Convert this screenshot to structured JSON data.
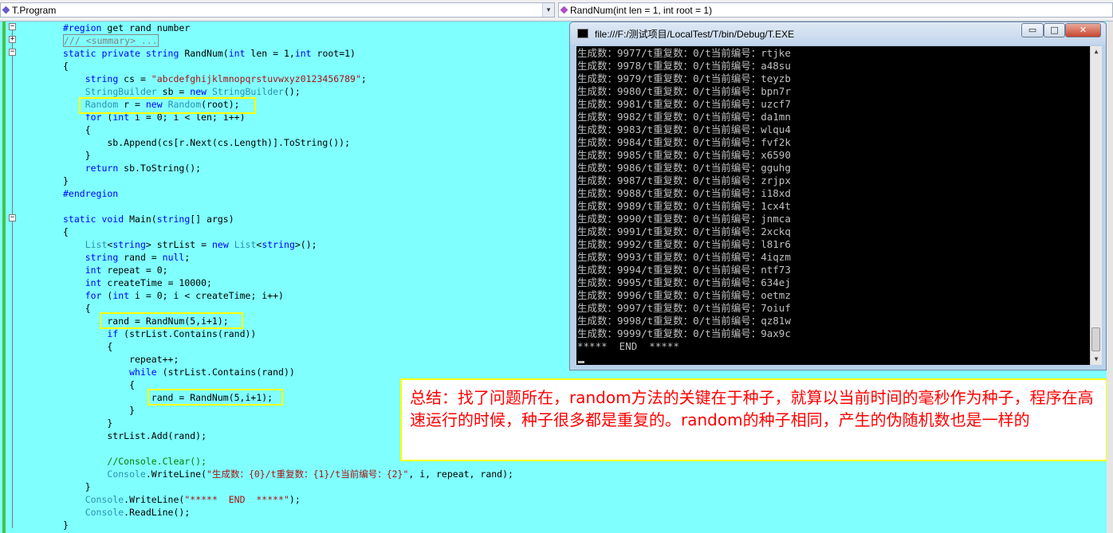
{
  "navbar": {
    "class_combo": "T.Program",
    "member_combo": "RandNum(int len = 1, int root = 1)",
    "dropdown_glyph": "▾"
  },
  "code_lines": [
    {
      "parts": [
        [
          "kw",
          "#region"
        ],
        [
          "",
          " get rand number"
        ]
      ]
    },
    {
      "parts": [
        [
          "cmt",
          "/// <summary> ..."
        ]
      ]
    },
    {
      "parts": [
        [
          "kw",
          "static private string "
        ],
        [
          "",
          "RandNum("
        ],
        [
          "kw",
          "int"
        ],
        [
          "",
          " len = 1,"
        ],
        [
          "kw",
          "int"
        ],
        [
          "",
          " root=1)"
        ]
      ]
    },
    {
      "parts": [
        [
          "",
          "{"
        ]
      ]
    },
    {
      "parts": [
        [
          "",
          "    "
        ],
        [
          "kw",
          "string"
        ],
        [
          "",
          " cs = "
        ],
        [
          "st",
          "\"abcdefghijklmnopqrstuvwxyz0123456789\""
        ],
        [
          "",
          ";"
        ]
      ]
    },
    {
      "parts": [
        [
          "",
          "    "
        ],
        [
          "ty",
          "StringBuilder"
        ],
        [
          "",
          " sb = "
        ],
        [
          "kw",
          "new "
        ],
        [
          "ty",
          "StringBuilder"
        ],
        [
          "",
          "();"
        ]
      ]
    },
    {
      "parts": [
        [
          "",
          "    "
        ],
        [
          "ty",
          "Random"
        ],
        [
          "",
          " r = "
        ],
        [
          "kw",
          "new "
        ],
        [
          "ty",
          "Random"
        ],
        [
          "",
          "(root);"
        ]
      ]
    },
    {
      "parts": [
        [
          "",
          "    "
        ],
        [
          "kw",
          "for"
        ],
        [
          "",
          " ("
        ],
        [
          "kw",
          "int"
        ],
        [
          "",
          " i = 0; i < len; i++)"
        ]
      ]
    },
    {
      "parts": [
        [
          "",
          "    {"
        ]
      ]
    },
    {
      "parts": [
        [
          "",
          "        sb.Append(cs[r.Next(cs.Length)].ToString());"
        ]
      ]
    },
    {
      "parts": [
        [
          "",
          "    }"
        ]
      ]
    },
    {
      "parts": [
        [
          "",
          "    "
        ],
        [
          "kw",
          "return"
        ],
        [
          "",
          " sb.ToString();"
        ]
      ]
    },
    {
      "parts": [
        [
          "",
          "}"
        ]
      ]
    },
    {
      "parts": [
        [
          "kw",
          "#endregion"
        ]
      ]
    },
    {
      "parts": [
        [
          "",
          ""
        ]
      ]
    },
    {
      "parts": [
        [
          "kw",
          "static void "
        ],
        [
          "",
          "Main("
        ],
        [
          "kw",
          "string"
        ],
        [
          "",
          "[] args)"
        ]
      ]
    },
    {
      "parts": [
        [
          "",
          "{"
        ]
      ]
    },
    {
      "parts": [
        [
          "",
          "    "
        ],
        [
          "ty",
          "List"
        ],
        [
          "",
          "<"
        ],
        [
          "kw",
          "string"
        ],
        [
          "",
          "> strList = "
        ],
        [
          "kw",
          "new "
        ],
        [
          "ty",
          "List"
        ],
        [
          "",
          "<"
        ],
        [
          "kw",
          "string"
        ],
        [
          "",
          ">();"
        ]
      ]
    },
    {
      "parts": [
        [
          "",
          "    "
        ],
        [
          "kw",
          "string"
        ],
        [
          "",
          " rand = "
        ],
        [
          "kw",
          "null"
        ],
        [
          "",
          ";"
        ]
      ]
    },
    {
      "parts": [
        [
          "",
          "    "
        ],
        [
          "kw",
          "int"
        ],
        [
          "",
          " repeat = 0;"
        ]
      ]
    },
    {
      "parts": [
        [
          "",
          "    "
        ],
        [
          "kw",
          "int"
        ],
        [
          "",
          " createTime = 10000;"
        ]
      ]
    },
    {
      "parts": [
        [
          "",
          "    "
        ],
        [
          "kw",
          "for"
        ],
        [
          "",
          " ("
        ],
        [
          "kw",
          "int"
        ],
        [
          "",
          " i = 0; i < createTime; i++)"
        ]
      ]
    },
    {
      "parts": [
        [
          "",
          "    {"
        ]
      ]
    },
    {
      "parts": [
        [
          "",
          "        rand = RandNum(5,i+1);"
        ]
      ]
    },
    {
      "parts": [
        [
          "",
          "        "
        ],
        [
          "kw",
          "if"
        ],
        [
          "",
          " (strList.Contains(rand))"
        ]
      ]
    },
    {
      "parts": [
        [
          "",
          "        {"
        ]
      ]
    },
    {
      "parts": [
        [
          "",
          "            repeat++;"
        ]
      ]
    },
    {
      "parts": [
        [
          "",
          "            "
        ],
        [
          "kw",
          "while"
        ],
        [
          "",
          " (strList.Contains(rand))"
        ]
      ]
    },
    {
      "parts": [
        [
          "",
          "            {"
        ]
      ]
    },
    {
      "parts": [
        [
          "",
          "                rand = RandNum(5,i+1);"
        ]
      ]
    },
    {
      "parts": [
        [
          "",
          "            }"
        ]
      ]
    },
    {
      "parts": [
        [
          "",
          "        }"
        ]
      ]
    },
    {
      "parts": [
        [
          "",
          "        strList.Add(rand);"
        ]
      ]
    },
    {
      "parts": [
        [
          "",
          ""
        ]
      ]
    },
    {
      "parts": [
        [
          "",
          "        "
        ],
        [
          "cm",
          "//Console.Clear();"
        ]
      ]
    },
    {
      "parts": [
        [
          "",
          "        "
        ],
        [
          "ty",
          "Console"
        ],
        [
          "",
          ".WriteLine("
        ],
        [
          "st",
          "\"生成数：{0}/t重复数：{1}/t当前编号：{2}\""
        ],
        [
          "",
          ", i, repeat, rand);"
        ]
      ]
    },
    {
      "parts": [
        [
          "",
          "    }"
        ]
      ]
    },
    {
      "parts": [
        [
          "",
          "    "
        ],
        [
          "ty",
          "Console"
        ],
        [
          "",
          ".WriteLine("
        ],
        [
          "st",
          "\"*****  END  *****\""
        ],
        [
          "",
          ");"
        ]
      ]
    },
    {
      "parts": [
        [
          "",
          "    "
        ],
        [
          "ty",
          "Console"
        ],
        [
          "",
          ".ReadLine();"
        ]
      ]
    },
    {
      "parts": [
        [
          "",
          "}"
        ]
      ]
    }
  ],
  "console": {
    "title": "file:///F:/测试项目/LocalTest/T/bin/Debug/T.EXE",
    "buttons": {
      "minimize": "▭",
      "maximize": "□",
      "close": "✕"
    },
    "lines": [
      "生成数：9977/t重复数：0/t当前编号：rtjke",
      "生成数：9978/t重复数：0/t当前编号：a48su",
      "生成数：9979/t重复数：0/t当前编号：teyzb",
      "生成数：9980/t重复数：0/t当前编号：bpn7r",
      "生成数：9981/t重复数：0/t当前编号：uzcf7",
      "生成数：9982/t重复数：0/t当前编号：da1mn",
      "生成数：9983/t重复数：0/t当前编号：wlqu4",
      "生成数：9984/t重复数：0/t当前编号：fvf2k",
      "生成数：9985/t重复数：0/t当前编号：x6590",
      "生成数：9986/t重复数：0/t当前编号：gguhg",
      "生成数：9987/t重复数：0/t当前编号：zrjpx",
      "生成数：9988/t重复数：0/t当前编号：i18xd",
      "生成数：9989/t重复数：0/t当前编号：1cx4t",
      "生成数：9990/t重复数：0/t当前编号：jnmca",
      "生成数：9991/t重复数：0/t当前编号：2xckq",
      "生成数：9992/t重复数：0/t当前编号：l81r6",
      "生成数：9993/t重复数：0/t当前编号：4iqzm",
      "生成数：9994/t重复数：0/t当前编号：ntf73",
      "生成数：9995/t重复数：0/t当前编号：634ej",
      "生成数：9996/t重复数：0/t当前编号：oetmz",
      "生成数：9997/t重复数：0/t当前编号：7oiuf",
      "生成数：9998/t重复数：0/t当前编号：qz81w",
      "生成数：9999/t重复数：0/t当前编号：9ax9c",
      "*****  END  *****"
    ]
  },
  "note": {
    "text": "总结：找了问题所在，random方法的关键在于种子，就算以当前时间的毫秒作为种子，程序在高速运行的时候，种子很多都是重复的。random的种子相同，产生的伪随机数也是一样的"
  },
  "colors": {
    "editor_bg": "#80ffff",
    "keyword": "#0000ff",
    "type": "#2b91af",
    "string": "#a31515",
    "comment": "#008000",
    "highlight_box": "#ffff00",
    "note_text": "#ff0000"
  }
}
